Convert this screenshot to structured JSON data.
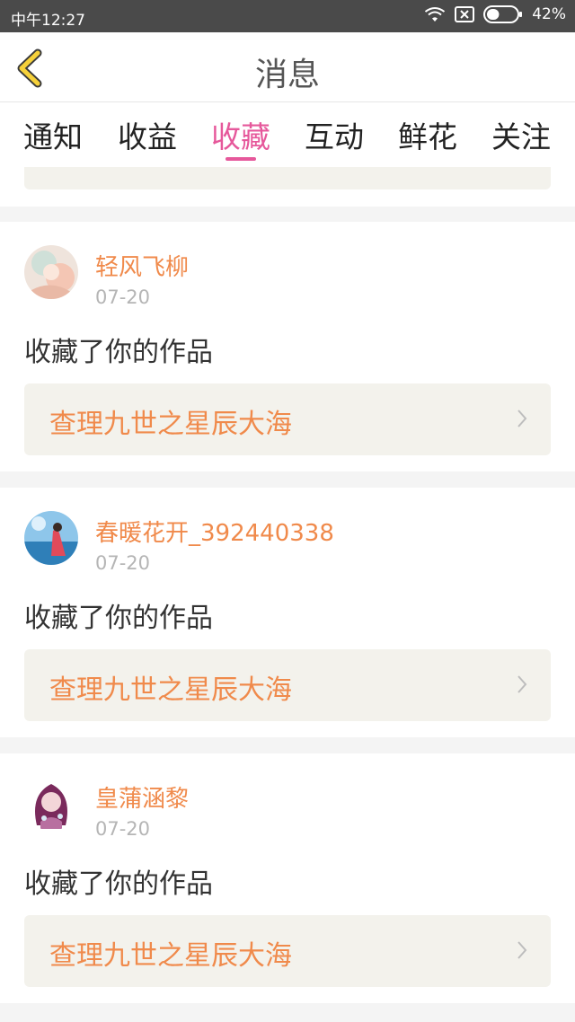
{
  "status_bar": {
    "time": "中午12:27",
    "battery_percent": "42%",
    "battery_level": 0.42,
    "icons": [
      "wifi-icon",
      "sim-x-icon",
      "battery-icon"
    ]
  },
  "header": {
    "title": "消息",
    "back_icon": "chevron-left-icon"
  },
  "tabs": [
    {
      "label": "通知",
      "active": false
    },
    {
      "label": "收益",
      "active": false
    },
    {
      "label": "收藏",
      "active": true
    },
    {
      "label": "互动",
      "active": false
    },
    {
      "label": "鲜花",
      "active": false
    },
    {
      "label": "关注",
      "active": false
    }
  ],
  "messages": [
    {
      "username": "轻风飞柳",
      "date": "07-20",
      "action": "收藏了你的作品",
      "work_title": "查理九世之星辰大海"
    },
    {
      "username": "春暖花开_392440338",
      "date": "07-20",
      "action": "收藏了你的作品",
      "work_title": "查理九世之星辰大海"
    },
    {
      "username": "皇蒲涵黎",
      "date": "07-20",
      "action": "收藏了你的作品",
      "work_title": "查理九世之星辰大海"
    }
  ],
  "colors": {
    "accent_pink": "#e6589b",
    "username_orange": "#f08a4b",
    "back_arrow_yellow": "#f6d13a"
  }
}
